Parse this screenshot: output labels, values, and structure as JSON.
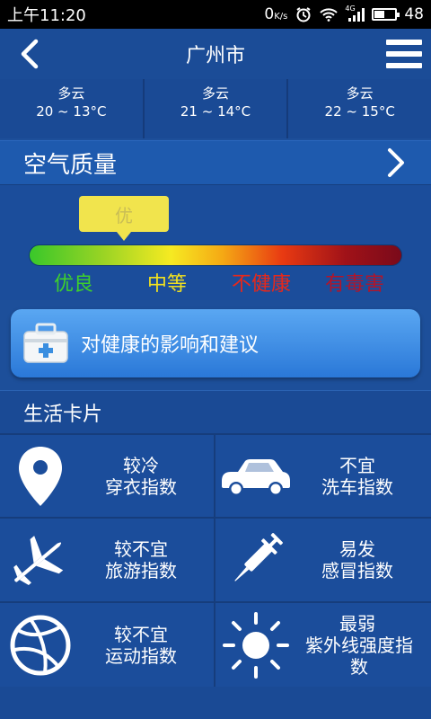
{
  "status": {
    "time": "上午11:20",
    "net": "0",
    "signal_type": "4G",
    "battery": "48",
    "battery_fraction": 0.48
  },
  "header": {
    "title": "广州市"
  },
  "forecast": [
    {
      "weather": "多云",
      "temp": "20 ~ 13°C"
    },
    {
      "weather": "多云",
      "temp": "21 ~ 14°C"
    },
    {
      "weather": "多云",
      "temp": "22 ~ 15°C"
    }
  ],
  "air": {
    "label": "空气质量",
    "current": "优",
    "levels": [
      "优良",
      "中等",
      "不健康",
      "有毒害"
    ]
  },
  "advice": {
    "label": "对健康的影响和建议"
  },
  "life": {
    "title": "生活卡片",
    "cards": [
      {
        "line1": "较冷",
        "line2": "穿衣指数",
        "icon": "location-pin-icon"
      },
      {
        "line1": "不宜",
        "line2": "洗车指数",
        "icon": "car-icon"
      },
      {
        "line1": "较不宜",
        "line2": "旅游指数",
        "icon": "airplane-icon"
      },
      {
        "line1": "易发",
        "line2": "感冒指数",
        "icon": "syringe-icon"
      },
      {
        "line1": "较不宜",
        "line2": "运动指数",
        "icon": "ball-icon"
      },
      {
        "line1": "最弱",
        "line2": "紫外线强度指数",
        "icon": "sun-icon"
      }
    ]
  },
  "colors": {
    "bg": "#1d4f9a",
    "good": "#3ed12b",
    "moderate": "#f2e11f",
    "unhealthy": "#e8281a",
    "hazardous": "#b2152a",
    "bubble": "#f1e44d"
  }
}
